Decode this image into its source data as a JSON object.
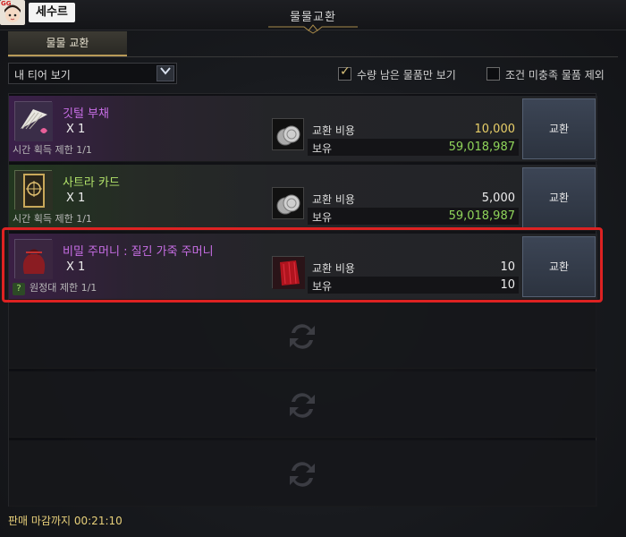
{
  "window": {
    "title": "물물교환",
    "avatar_badge": "GG",
    "nametag": "세수르"
  },
  "tabs": [
    {
      "label": "물물 교환",
      "active": true
    }
  ],
  "filter": {
    "tier_select": "내 티어 보기",
    "checkbox_remaining": {
      "label": "수량 남은 물품만 보기",
      "checked": true
    },
    "checkbox_exclude": {
      "label": "조건 미충족 물품 제외",
      "checked": false
    }
  },
  "items": [
    {
      "name": "깃털 부채",
      "name_color": "#c86ee6",
      "icon": "feather-fan-icon",
      "qty": "X 1",
      "limit": "시간 획득 제한 1/1",
      "cost_icon": "silver-coins-icon",
      "cost_label": "교환 비용",
      "cost_value": "10,000",
      "own_label": "보유",
      "own_value": "59,018,987",
      "button": "교환"
    },
    {
      "name": "사트라 카드",
      "name_color": "#b2e36a",
      "icon": "card-icon",
      "qty": "X 1",
      "limit": "시간 획득 제한 1/1",
      "cost_icon": "silver-coins-icon",
      "cost_label": "교환 비용",
      "cost_value": "5,000",
      "own_label": "보유",
      "own_value": "59,018,987",
      "button": "교환"
    },
    {
      "name": "비밀 주머니 : 질긴 가죽 주머니",
      "name_color": "#c86ee6",
      "icon": "pouch-icon",
      "qty": "X 1",
      "limit": "원정대 제한 1/1",
      "limit_marker": "?",
      "cost_icon": "red-cloth-icon",
      "cost_label": "교환 비용",
      "cost_value": "10",
      "own_label": "보유",
      "own_value": "10",
      "button": "교환"
    }
  ],
  "footer": {
    "deadline": "판매 마감까지 00:21:10"
  },
  "colors": {
    "accent_gold": "#b89a58",
    "highlight_red": "#dd2222",
    "cost_yellow": "#e8cf68",
    "own_green": "#8fd45a"
  }
}
